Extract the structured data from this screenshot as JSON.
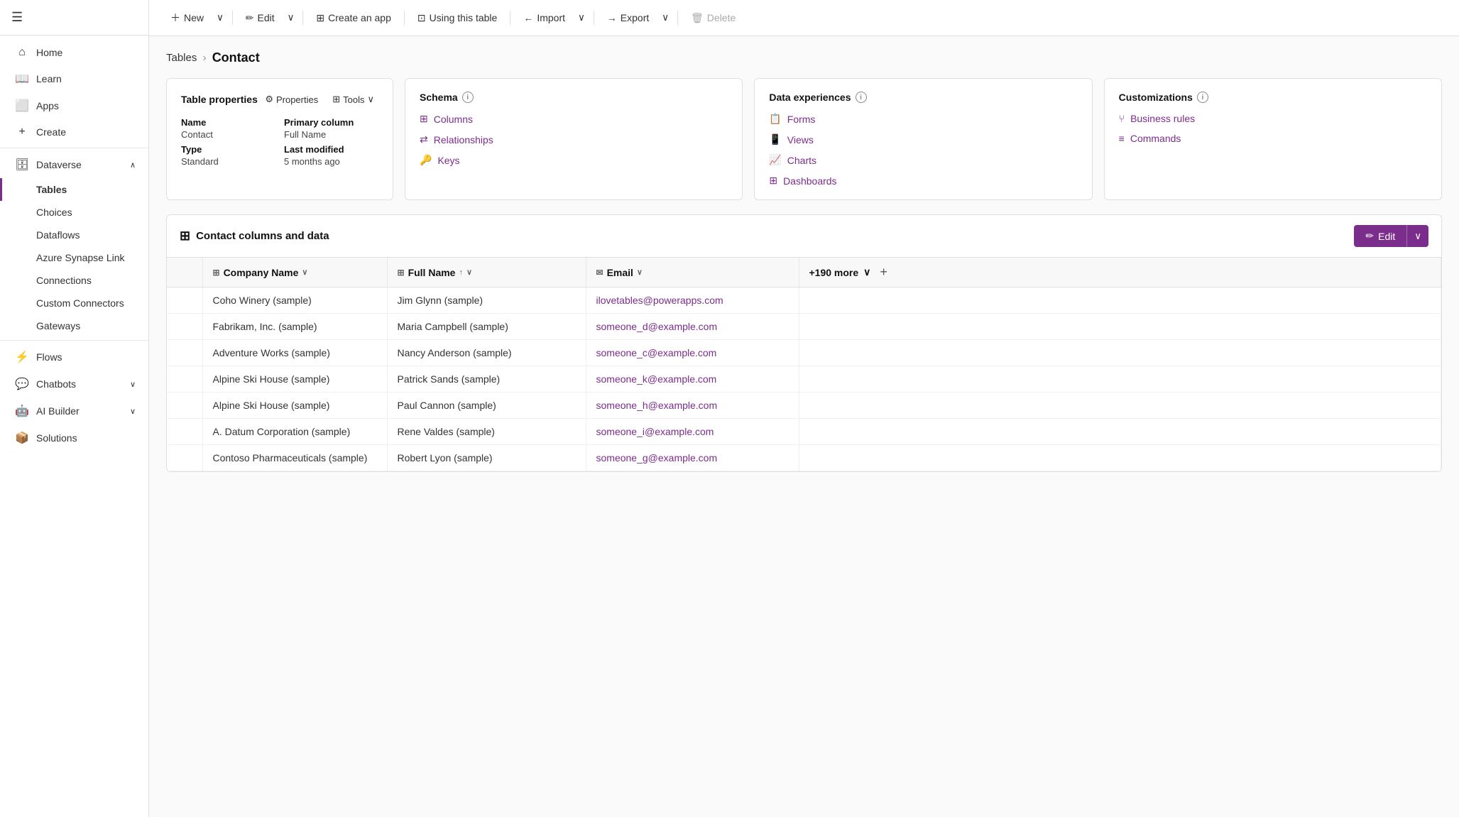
{
  "sidebar": {
    "hamburger": "☰",
    "nav_items": [
      {
        "id": "home",
        "label": "Home",
        "icon": "⌂",
        "active": false,
        "indent": false
      },
      {
        "id": "learn",
        "label": "Learn",
        "icon": "📖",
        "active": false,
        "indent": false
      },
      {
        "id": "apps",
        "label": "Apps",
        "icon": "⬜",
        "active": false,
        "indent": false
      },
      {
        "id": "create",
        "label": "Create",
        "icon": "+",
        "active": false,
        "indent": false
      },
      {
        "id": "dataverse",
        "label": "Dataverse",
        "icon": "🗄",
        "active": false,
        "expanded": true,
        "indent": false
      },
      {
        "id": "tables",
        "label": "Tables",
        "active": true,
        "indent": true
      },
      {
        "id": "choices",
        "label": "Choices",
        "active": false,
        "indent": true
      },
      {
        "id": "dataflows",
        "label": "Dataflows",
        "active": false,
        "indent": true
      },
      {
        "id": "azure-synapse",
        "label": "Azure Synapse Link",
        "active": false,
        "indent": true
      },
      {
        "id": "connections",
        "label": "Connections",
        "active": false,
        "indent": true
      },
      {
        "id": "custom-connectors",
        "label": "Custom Connectors",
        "active": false,
        "indent": true
      },
      {
        "id": "gateways",
        "label": "Gateways",
        "active": false,
        "indent": true
      },
      {
        "id": "flows",
        "label": "Flows",
        "icon": "⚡",
        "active": false,
        "indent": false
      },
      {
        "id": "chatbots",
        "label": "Chatbots",
        "icon": "💬",
        "active": false,
        "indent": false,
        "hasChevron": true
      },
      {
        "id": "ai-builder",
        "label": "AI Builder",
        "icon": "🤖",
        "active": false,
        "indent": false,
        "hasChevron": true
      },
      {
        "id": "solutions",
        "label": "Solutions",
        "icon": "📦",
        "active": false,
        "indent": false
      }
    ]
  },
  "toolbar": {
    "new_label": "New",
    "edit_label": "Edit",
    "create_app_label": "Create an app",
    "using_table_label": "Using this table",
    "import_label": "Import",
    "export_label": "Export",
    "delete_label": "Delete"
  },
  "breadcrumb": {
    "parent": "Tables",
    "separator": "›",
    "current": "Contact"
  },
  "table_properties": {
    "card_title": "Table properties",
    "properties_btn": "Properties",
    "tools_btn": "Tools",
    "name_label": "Name",
    "name_value": "Contact",
    "type_label": "Type",
    "type_value": "Standard",
    "primary_column_label": "Primary column",
    "primary_column_value": "Full Name",
    "last_modified_label": "Last modified",
    "last_modified_value": "5 months ago"
  },
  "schema": {
    "card_title": "Schema",
    "info_icon": "i",
    "items": [
      {
        "id": "columns",
        "label": "Columns",
        "icon": "⊞"
      },
      {
        "id": "relationships",
        "label": "Relationships",
        "icon": "⇄"
      },
      {
        "id": "keys",
        "label": "Keys",
        "icon": "🔑"
      }
    ]
  },
  "data_experiences": {
    "card_title": "Data experiences",
    "info_icon": "i",
    "items": [
      {
        "id": "forms",
        "label": "Forms",
        "icon": "📋"
      },
      {
        "id": "views",
        "label": "Views",
        "icon": "📱"
      },
      {
        "id": "charts",
        "label": "Charts",
        "icon": "📈"
      },
      {
        "id": "dashboards",
        "label": "Dashboards",
        "icon": "⊞"
      }
    ]
  },
  "customizations": {
    "card_title": "Customizations",
    "info_icon": "i",
    "items": [
      {
        "id": "business-rules",
        "label": "Business rules",
        "icon": "⑂"
      },
      {
        "id": "commands",
        "label": "Commands",
        "icon": "≡"
      }
    ]
  },
  "data_section": {
    "title": "Contact columns and data",
    "edit_btn": "Edit",
    "columns": [
      {
        "id": "company",
        "label": "Company Name",
        "icon": "⊞",
        "has_dropdown": true
      },
      {
        "id": "fullname",
        "label": "Full Name",
        "icon": "⊞",
        "has_sort": true,
        "sort_dir": "↑",
        "has_dropdown": true
      },
      {
        "id": "email",
        "label": "Email",
        "icon": "✉",
        "has_dropdown": true
      }
    ],
    "more_label": "+190 more",
    "rows": [
      {
        "company": "Coho Winery (sample)",
        "fullname": "Jim Glynn (sample)",
        "email": "ilovetables@powerapps.com"
      },
      {
        "company": "Fabrikam, Inc. (sample)",
        "fullname": "Maria Campbell (sample)",
        "email": "someone_d@example.com"
      },
      {
        "company": "Adventure Works (sample)",
        "fullname": "Nancy Anderson (sample)",
        "email": "someone_c@example.com"
      },
      {
        "company": "Alpine Ski House (sample)",
        "fullname": "Patrick Sands (sample)",
        "email": "someone_k@example.com"
      },
      {
        "company": "Alpine Ski House (sample)",
        "fullname": "Paul Cannon (sample)",
        "email": "someone_h@example.com"
      },
      {
        "company": "A. Datum Corporation (sample)",
        "fullname": "Rene Valdes (sample)",
        "email": "someone_i@example.com"
      },
      {
        "company": "Contoso Pharmaceuticals (sample)",
        "fullname": "Robert Lyon (sample)",
        "email": "someone_g@example.com"
      }
    ]
  },
  "colors": {
    "accent": "#7B2D8B",
    "active_border": "#7B2D8B"
  }
}
